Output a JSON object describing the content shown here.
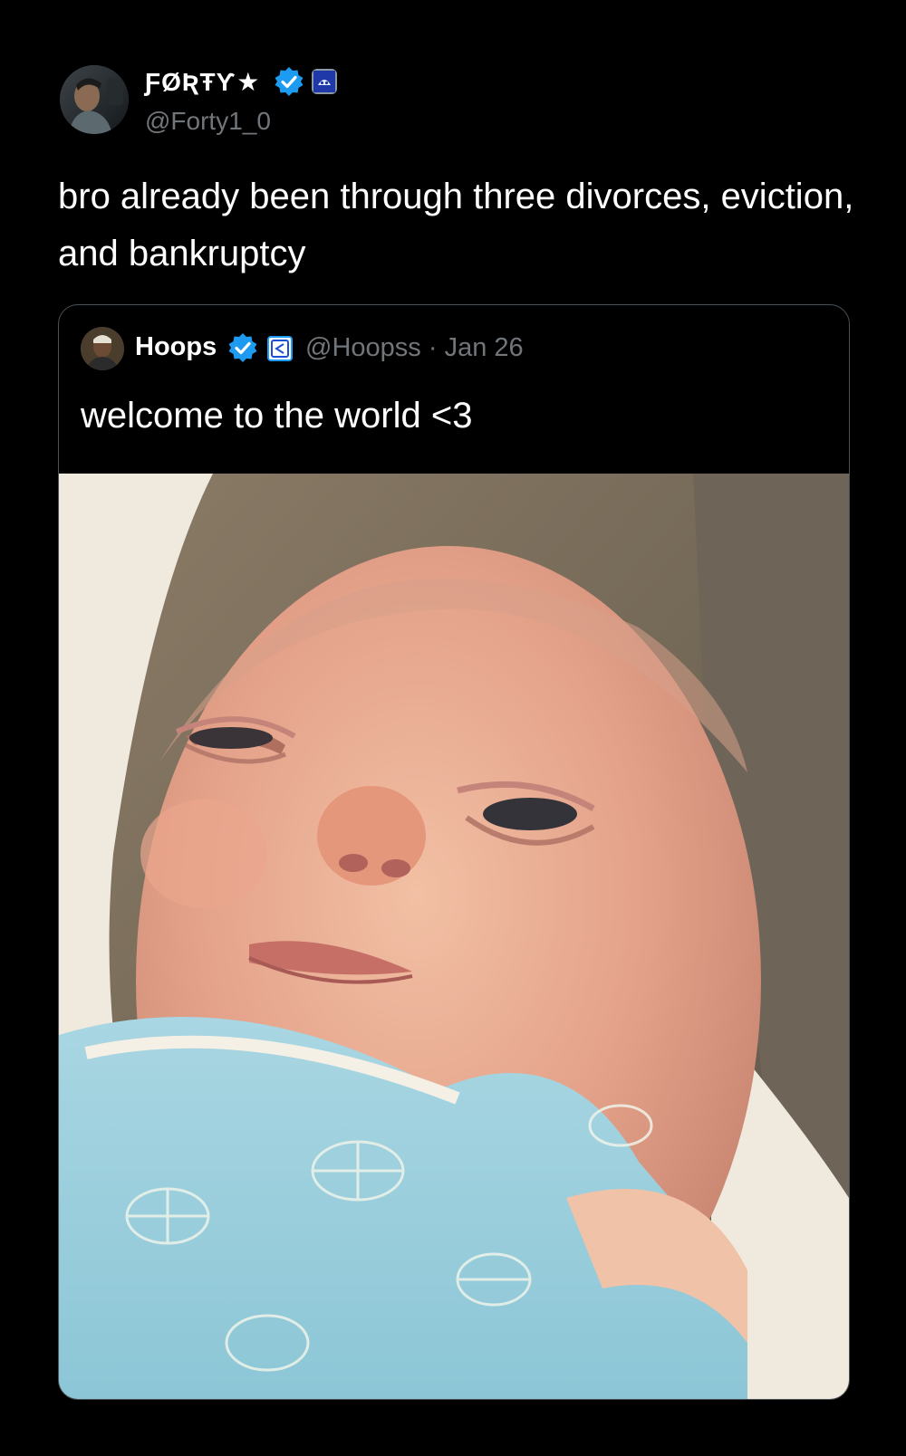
{
  "post": {
    "author": {
      "display_name": "ƑØƦŦƳ★",
      "handle": "@Forty1_0",
      "verified": true
    },
    "text": "bro already been through three divorces, eviction, and bankruptcy"
  },
  "quoted_post": {
    "author": {
      "display_name": "Hoops",
      "handle": "@Hoopss",
      "verified": true
    },
    "date": "Jan 26",
    "separator": "·",
    "text": "welcome to the world <3"
  },
  "icons": {
    "verified": "verified-check-icon",
    "affiliation": "affiliate-badge-icon"
  },
  "colors": {
    "background": "#000000",
    "verified_blue": "#1d9bf0",
    "secondary_text": "#71767b",
    "card_border": "#4a5157"
  }
}
